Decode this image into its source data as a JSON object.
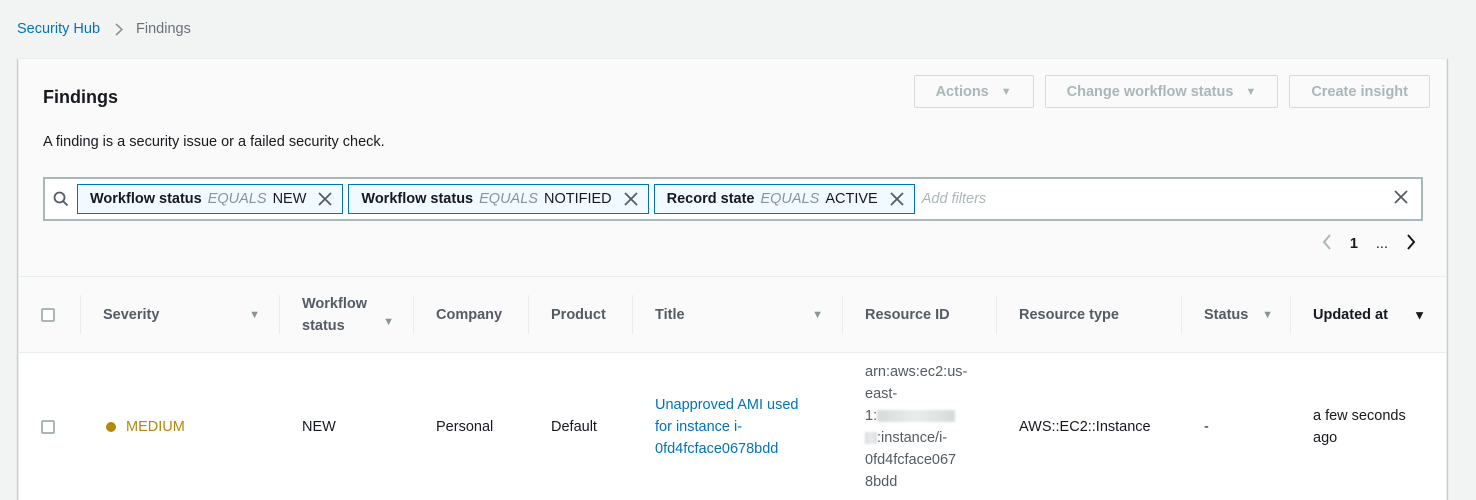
{
  "breadcrumb": {
    "root": "Security Hub",
    "current": "Findings"
  },
  "header": {
    "title": "Findings",
    "description": "A finding is a security issue or a failed security check.",
    "actions_label": "Actions",
    "change_workflow_label": "Change workflow status",
    "create_insight_label": "Create insight"
  },
  "filters": {
    "tokens": [
      {
        "field": "Workflow status",
        "op": "EQUALS",
        "value": "NEW"
      },
      {
        "field": "Workflow status",
        "op": "EQUALS",
        "value": "NOTIFIED"
      },
      {
        "field": "Record state",
        "op": "EQUALS",
        "value": "ACTIVE"
      }
    ],
    "placeholder": "Add filters"
  },
  "pagination": {
    "current_page": "1",
    "ellipsis": "..."
  },
  "table": {
    "columns": {
      "severity": "Severity",
      "workflow_line1": "Workflow",
      "workflow_line2": "status",
      "company": "Company",
      "product": "Product",
      "title": "Title",
      "resource_id": "Resource ID",
      "resource_type": "Resource type",
      "status": "Status",
      "updated_at": "Updated at"
    },
    "rows": [
      {
        "severity": "MEDIUM",
        "workflow": "NEW",
        "company": "Personal",
        "product": "Default",
        "title_line1": "Unapproved AMI used",
        "title_line2": "for instance i-",
        "title_line3": "0fd4fcface0678bdd",
        "resource_line1": "arn:aws:ec2:us-",
        "resource_line2": "east-",
        "resource_line3_prefix": "1:",
        "resource_line4_suffix": ":instance/i-",
        "resource_line5": "0fd4fcface067",
        "resource_line6": "8bdd",
        "resource_type": "AWS::EC2::Instance",
        "status": "-",
        "updated_line1": "a few seconds",
        "updated_line2": "ago"
      }
    ]
  },
  "colors": {
    "link": "#0073bb",
    "medium": "#b7870d"
  }
}
